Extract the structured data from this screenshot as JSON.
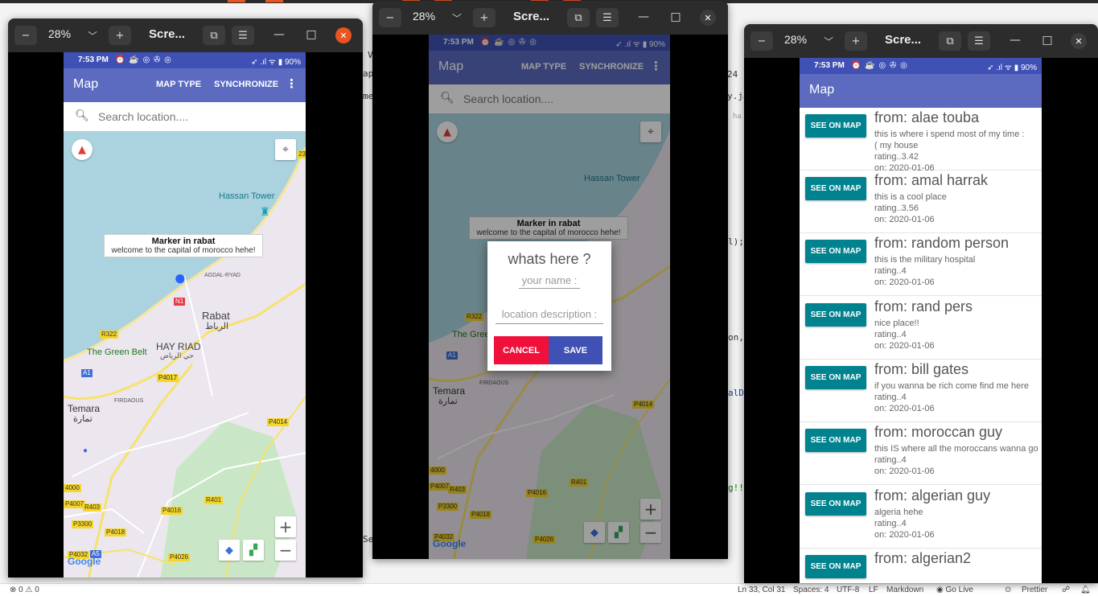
{
  "editor": {
    "code_fragments": [
      "V",
      "ap",
      "me",
      "24",
      "y.jav",
      "ha",
      "l);",
      "on,",
      "alD",
      "g!!",
      "Se"
    ],
    "status": {
      "problems": "⊗ 0 ⚠ 0",
      "position": "Ln 33, Col 31",
      "spaces": "Spaces: 4",
      "encoding": "UTF-8",
      "eol": "LF",
      "language": "Markdown",
      "golive": "Go Live",
      "prettier": "Prettier"
    }
  },
  "windows": [
    {
      "zoom": "28%",
      "title": "Scre...",
      "zoom_out": "−",
      "zoom_in": "+",
      "chevron": "﹀",
      "minimize": "—",
      "maximize": "□",
      "close": "✕"
    },
    {
      "zoom": "28%",
      "title": "Scre...",
      "zoom_out": "−",
      "zoom_in": "+",
      "chevron": "﹀",
      "minimize": "—",
      "maximize": "□",
      "close": "✕"
    },
    {
      "zoom": "28%",
      "title": "Scre...",
      "zoom_out": "−",
      "zoom_in": "+",
      "chevron": "﹀",
      "minimize": "—",
      "maximize": "□",
      "close": "✕"
    }
  ],
  "phone": {
    "time": "7:53 PM",
    "status_icons": "⏰ ☕ ◎ ✇ ◎",
    "status_right": "➶ .ıl ᯤ ▮ 90%",
    "app_title": "Map",
    "action_map_type": "MAP TYPE",
    "action_sync": "SYNCHRONIZE",
    "overflow": "⋮",
    "search_placeholder": "Search location...."
  },
  "map": {
    "labels": {
      "hassan_tower": "Hassan Tower",
      "rabat": "Rabat",
      "rabat_ar": "الرباط",
      "hay_riad": "HAY RIAD",
      "hay_riad_ar": "حي الرياض",
      "green_belt": "The Green Belt",
      "temara": "Temara",
      "temara_ar": "تمارة",
      "firdaous": "FIRDAOUS",
      "agdal": "AGDAL-RYAD",
      "google": "Google"
    },
    "roads": [
      "R322",
      "A1",
      "P4017",
      "P4014",
      "P4016",
      "R401",
      "P4007",
      "R403",
      "P3300",
      "P4018",
      "P4026",
      "P4032",
      "A5",
      "N1",
      "4000",
      "231"
    ],
    "marker_title": "Marker in rabat",
    "marker_snippet": "welcome to the capital of morocco hehe!",
    "zoom_in": "+",
    "zoom_out": "−"
  },
  "dialog": {
    "title": "whats here ?",
    "name_hint": "your name :",
    "desc_hint": "location description :",
    "cancel": "CANCEL",
    "save": "SAVE"
  },
  "list": {
    "button_label": "SEE ON MAP",
    "items": [
      {
        "from": "from: alae touba",
        "desc": "this is where i spend most of my time :",
        "desc2": "( my house",
        "rating": "rating..3.42",
        "date": "on: 2020-01-06"
      },
      {
        "from": "from: amal harrak",
        "desc": "this is a cool place",
        "desc2": "",
        "rating": "rating..3.56",
        "date": "on: 2020-01-06"
      },
      {
        "from": "from: random person",
        "desc": "this is the military hospital",
        "desc2": "",
        "rating": "rating..4",
        "date": "on: 2020-01-06"
      },
      {
        "from": "from: rand pers",
        "desc": "nice place!!",
        "desc2": "",
        "rating": "rating..4",
        "date": "on: 2020-01-06"
      },
      {
        "from": "from: bill gates",
        "desc": "if you wanna be rich come find me here",
        "desc2": "",
        "rating": "rating..4",
        "date": "on: 2020-01-06"
      },
      {
        "from": "from: moroccan guy",
        "desc": "this IS where all the moroccans wanna go",
        "desc2": "",
        "rating": "rating..4",
        "date": "on: 2020-01-06"
      },
      {
        "from": "from: algerian guy",
        "desc": "algeria hehe",
        "desc2": "",
        "rating": "rating..4",
        "date": "on: 2020-01-06"
      },
      {
        "from": "from: algerian2",
        "desc": "",
        "desc2": "",
        "rating": "",
        "date": ""
      }
    ]
  },
  "colors": {
    "appbar": "#5c6bc0",
    "list_button": "#00838f",
    "cancel": "#f0103a",
    "save": "#3f51b5",
    "close_active": "#e95420"
  }
}
